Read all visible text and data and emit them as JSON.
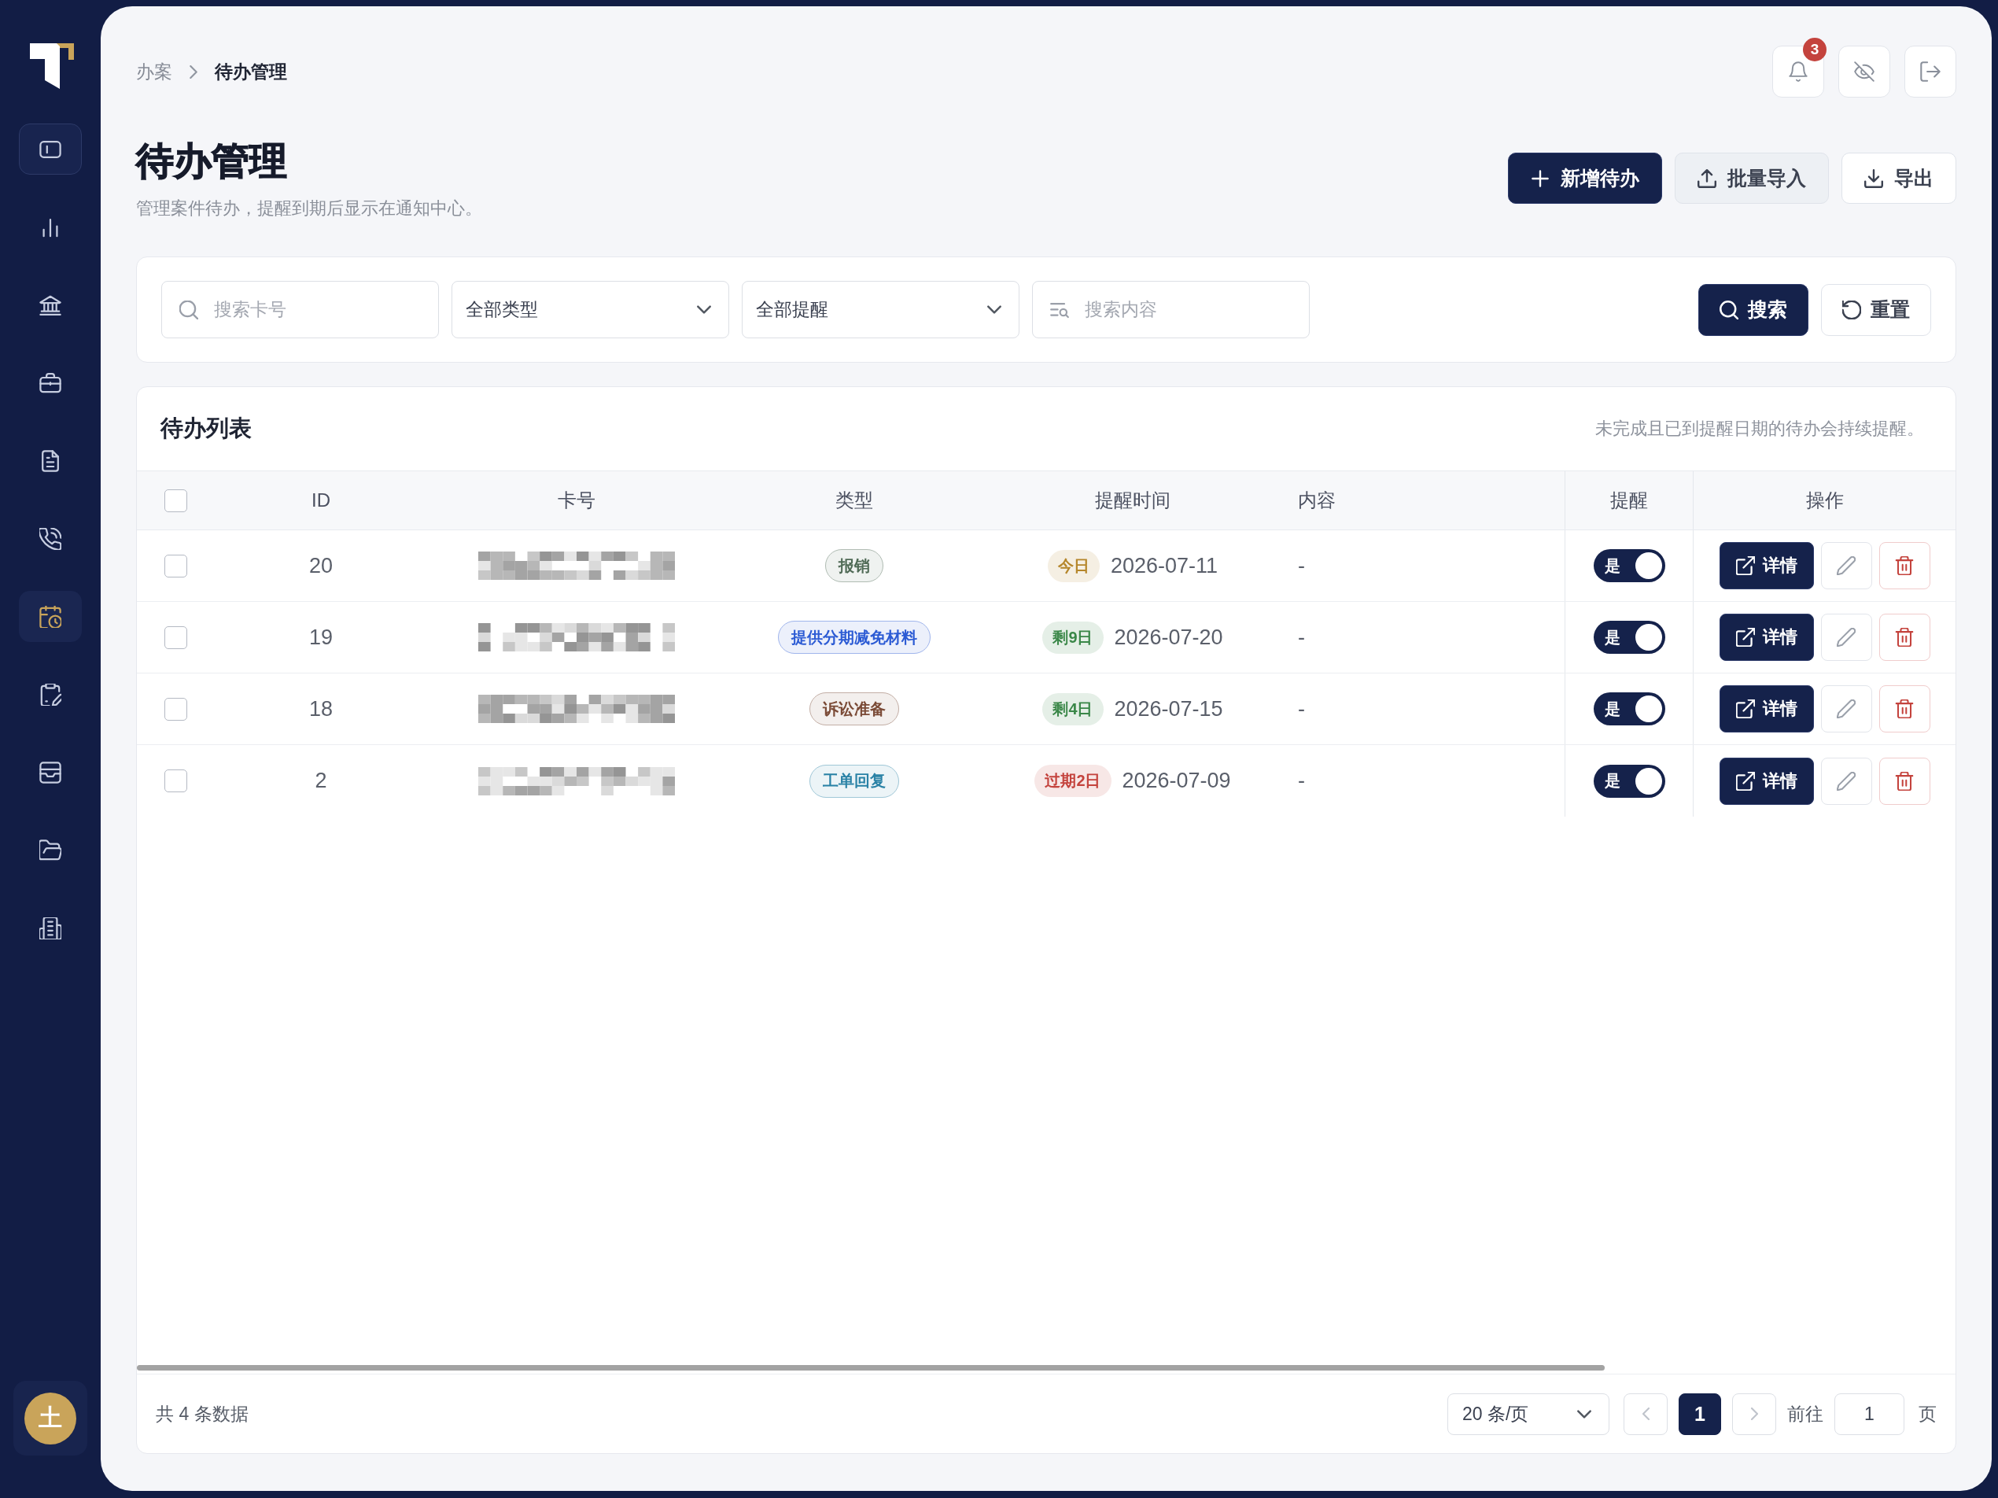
{
  "sidebar": {
    "items": [
      {
        "kind": "toggle",
        "selected": false
      },
      {
        "kind": "nav",
        "selected": false
      },
      {
        "kind": "nav",
        "selected": false
      },
      {
        "kind": "nav",
        "selected": false
      },
      {
        "kind": "nav",
        "selected": false
      },
      {
        "kind": "nav",
        "selected": false
      },
      {
        "kind": "nav",
        "selected": true
      },
      {
        "kind": "nav",
        "selected": false
      },
      {
        "kind": "nav",
        "selected": false
      },
      {
        "kind": "nav",
        "selected": false
      },
      {
        "kind": "nav",
        "selected": false
      }
    ],
    "avatar": "土"
  },
  "breadcrumb": [
    "办案",
    "待办管理"
  ],
  "top_bar": {
    "notification_badge": "3"
  },
  "page": {
    "title": "待办管理",
    "subtitle": "管理案件待办，提醒到期后显示在通知中心。"
  },
  "actions": [
    {
      "label": "新增待办",
      "kind": "primary"
    },
    {
      "label": "批量导入",
      "kind": "secondary"
    },
    {
      "label": "导出",
      "kind": "plain"
    }
  ],
  "filters": [
    {
      "kind": "search",
      "placeholder": "搜索卡号"
    },
    {
      "kind": "select",
      "value": "全部类型"
    },
    {
      "kind": "select",
      "value": "全部提醒"
    },
    {
      "kind": "content",
      "placeholder": "搜索内容"
    }
  ],
  "filter_buttons": [
    {
      "label": "搜索",
      "kind": "primary"
    },
    {
      "label": "重置",
      "kind": "plain"
    }
  ],
  "table": {
    "title": "待办列表",
    "note": "未完成且已到提醒日期的待办会持续提醒。",
    "select_all_checked": false,
    "columns": [
      "ID",
      "卡号",
      "类型",
      "提醒时间",
      "内容",
      "提醒",
      "操作"
    ],
    "rows": [
      {
        "checked": false,
        "id": "20",
        "type": {
          "label": "报销",
          "color": "#4f6a55"
        },
        "remind": {
          "label": "今日",
          "color": "#b5862a"
        },
        "time": "2026-07-11",
        "content": "-",
        "reminder": {
          "label": "是",
          "on": true
        },
        "detail_label": "详情"
      },
      {
        "checked": false,
        "id": "19",
        "type": {
          "label": "提供分期减免材料",
          "color": "#2c5bd4"
        },
        "remind": {
          "label": "剩9日",
          "color": "#3a8748"
        },
        "time": "2026-07-20",
        "content": "-",
        "reminder": {
          "label": "是",
          "on": true
        },
        "detail_label": "详情"
      },
      {
        "checked": false,
        "id": "18",
        "type": {
          "label": "诉讼准备",
          "color": "#7a4a36"
        },
        "remind": {
          "label": "剩4日",
          "color": "#3a8748"
        },
        "time": "2026-07-15",
        "content": "-",
        "reminder": {
          "label": "是",
          "on": true
        },
        "detail_label": "详情"
      },
      {
        "checked": false,
        "id": "2",
        "type": {
          "label": "工单回复",
          "color": "#2a82a6"
        },
        "remind": {
          "label": "过期2日",
          "color": "#c4433d"
        },
        "time": "2026-07-09",
        "content": "-",
        "reminder": {
          "label": "是",
          "on": true
        },
        "detail_label": "详情"
      }
    ]
  },
  "pagination": {
    "total": "共 4 条数据",
    "page_size": "20 条/页",
    "prev_disabled": true,
    "next_disabled": true,
    "pages": [
      {
        "label": "1",
        "selected": true
      }
    ],
    "goto_label": "前往",
    "goto_value": "1",
    "page_suffix": "页"
  }
}
